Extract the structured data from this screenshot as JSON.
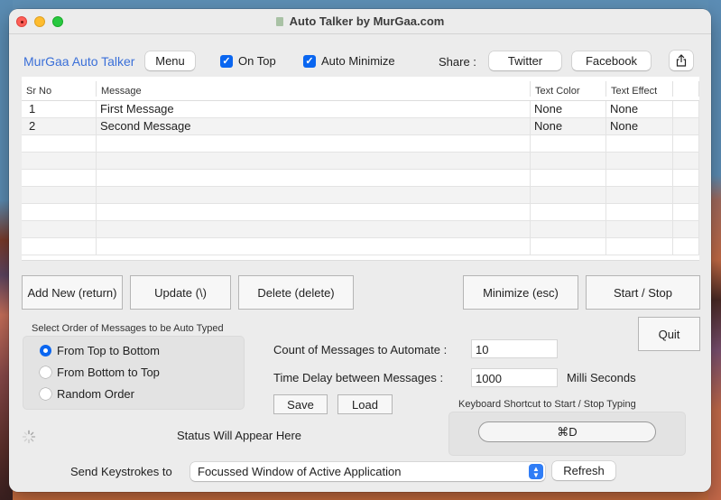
{
  "window": {
    "title": "Auto Talker by MurGaa.com"
  },
  "toolbar": {
    "brand": "MurGaa Auto Talker",
    "menu_label": "Menu",
    "on_top": {
      "label": "On Top",
      "checked": true
    },
    "auto_minimize": {
      "label": "Auto Minimize",
      "checked": true
    },
    "share_label": "Share :",
    "twitter_label": "Twitter",
    "facebook_label": "Facebook",
    "share_icon": "share-icon"
  },
  "table": {
    "columns": [
      "Sr No",
      "Message",
      "Text Color",
      "Text Effect"
    ],
    "rows": [
      {
        "sr": "1",
        "message": "First Message",
        "color": "None",
        "effect": "None"
      },
      {
        "sr": "2",
        "message": "Second Message",
        "color": "None",
        "effect": "None"
      }
    ]
  },
  "actions": {
    "add_new": "Add New (return)",
    "update": "Update (\\)",
    "delete": "Delete (delete)",
    "minimize": "Minimize (esc)",
    "start_stop": "Start / Stop",
    "quit": "Quit"
  },
  "order": {
    "label": "Select Order of Messages to be Auto Typed",
    "options": [
      "From Top to Bottom",
      "From Bottom to Top",
      "Random Order"
    ],
    "selected": "From Top to Bottom"
  },
  "settings": {
    "count_label": "Count of Messages to Automate :",
    "count_value": "10",
    "delay_label": "Time Delay between Messages :",
    "delay_value": "1000",
    "delay_unit": "Milli Seconds",
    "save_label": "Save",
    "load_label": "Load"
  },
  "shortcut": {
    "label": "Keyboard Shortcut to Start / Stop Typing",
    "value": "⌘D"
  },
  "status": {
    "text": "Status Will Appear Here"
  },
  "target": {
    "label": "Send Keystrokes to",
    "selected": "Focussed Window of Active Application",
    "refresh_label": "Refresh"
  },
  "colors": {
    "accent": "#0a66f0",
    "brand": "#3a6fd8"
  }
}
